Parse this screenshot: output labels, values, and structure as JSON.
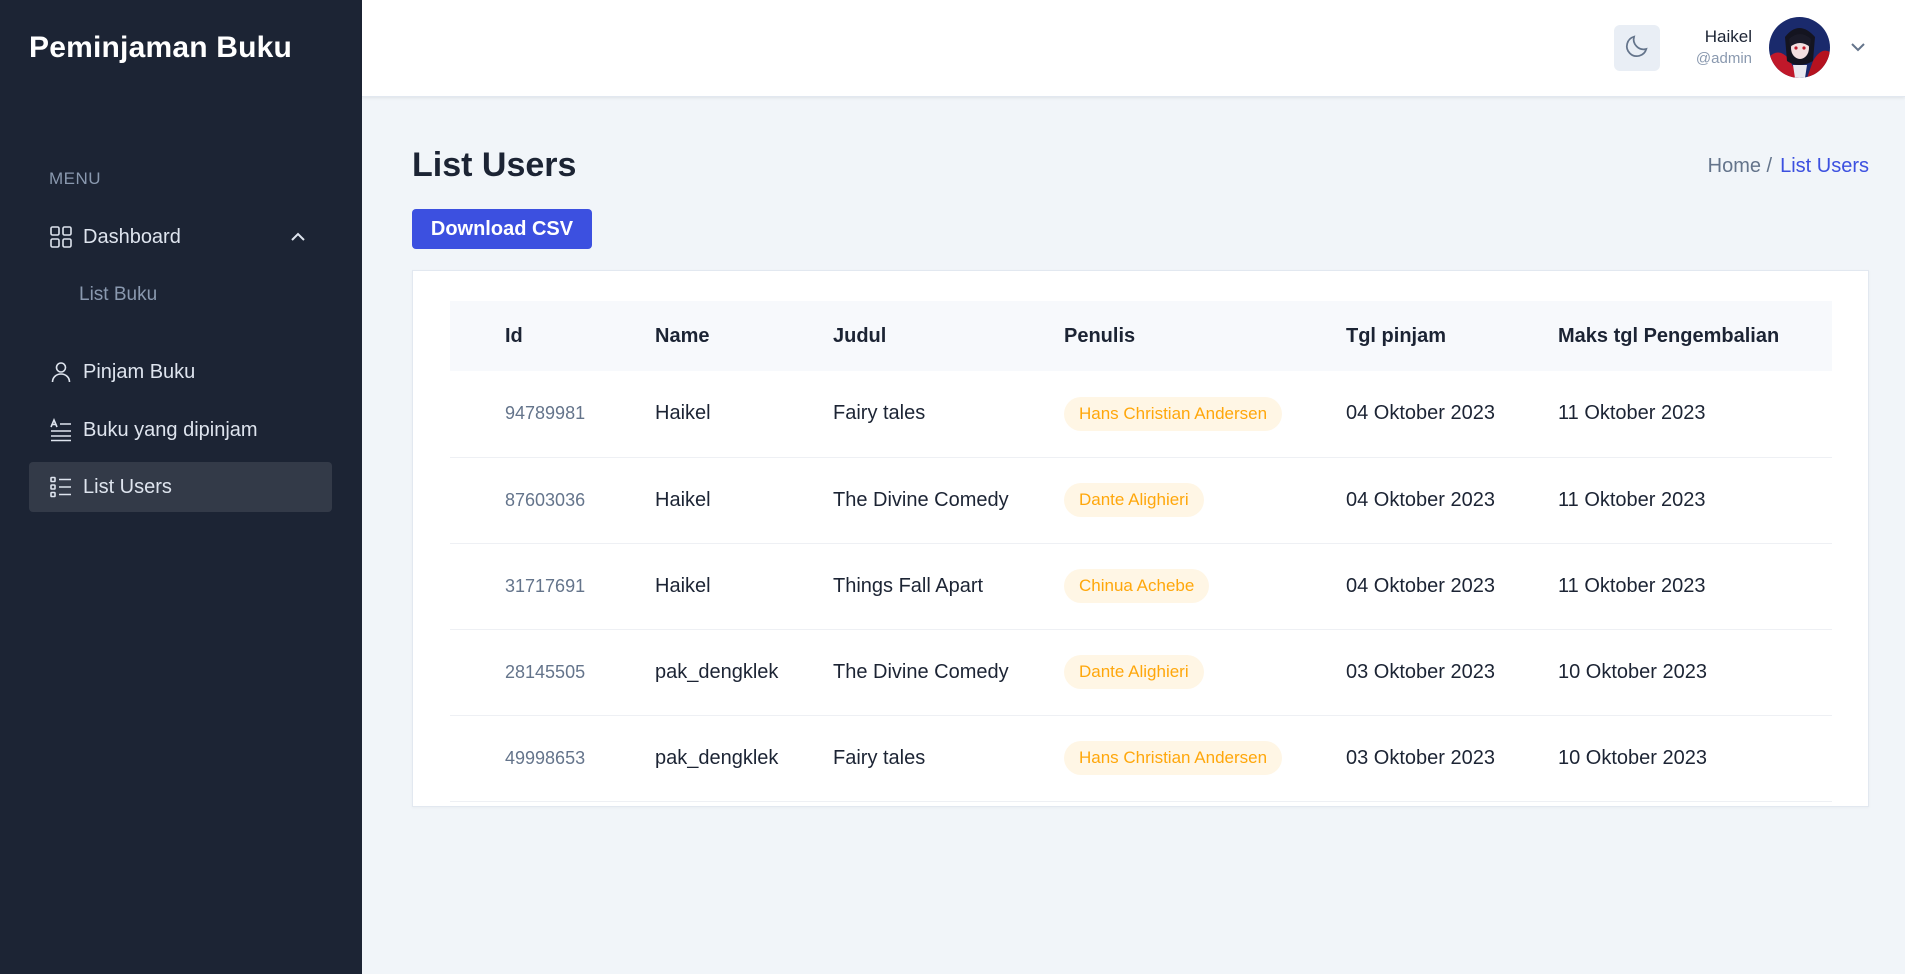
{
  "sidebar": {
    "brand": "Peminjaman Buku",
    "menu_heading": "MENU",
    "items": [
      {
        "label": "Dashboard",
        "icon": "dashboard-grid-icon",
        "expanded": true
      },
      {
        "label": "List Buku",
        "sub": true
      },
      {
        "label": "Pinjam Buku",
        "icon": "user-icon"
      },
      {
        "label": "Buku yang dipinjam",
        "icon": "text-list-icon"
      },
      {
        "label": "List Users",
        "icon": "list-icon",
        "active": true
      }
    ]
  },
  "header": {
    "user_name": "Haikel",
    "user_role": "@admin",
    "theme_icon": "moon-icon"
  },
  "page": {
    "title": "List Users",
    "breadcrumb": {
      "home": "Home /",
      "current": "List Users"
    },
    "download_label": "Download CSV"
  },
  "table": {
    "columns": [
      "Id",
      "Name",
      "Judul",
      "Penulis",
      "Tgl pinjam",
      "Maks tgl Pengembalian"
    ],
    "rows": [
      {
        "id": "94789981",
        "name": "Haikel",
        "judul": "Fairy tales",
        "penulis": "Hans Christian Andersen",
        "tgl_pinjam": "04 Oktober 2023",
        "maks": "11 Oktober 2023"
      },
      {
        "id": "87603036",
        "name": "Haikel",
        "judul": "The Divine Comedy",
        "penulis": "Dante Alighieri",
        "tgl_pinjam": "04 Oktober 2023",
        "maks": "11 Oktober 2023"
      },
      {
        "id": "31717691",
        "name": "Haikel",
        "judul": "Things Fall Apart",
        "penulis": "Chinua Achebe",
        "tgl_pinjam": "04 Oktober 2023",
        "maks": "11 Oktober 2023"
      },
      {
        "id": "28145505",
        "name": "pak_dengklek",
        "judul": "The Divine Comedy",
        "penulis": "Dante Alighieri",
        "tgl_pinjam": "03 Oktober 2023",
        "maks": "10 Oktober 2023"
      },
      {
        "id": "49998653",
        "name": "pak_dengklek",
        "judul": "Fairy tales",
        "penulis": "Hans Christian Andersen",
        "tgl_pinjam": "03 Oktober 2023",
        "maks": "10 Oktober 2023"
      }
    ]
  },
  "colors": {
    "sidebar_bg": "#1c2434",
    "primary": "#3c50e0",
    "badge_bg": "#fff6e5",
    "badge_text": "#ffa70b",
    "page_bg": "#f1f5f9"
  }
}
